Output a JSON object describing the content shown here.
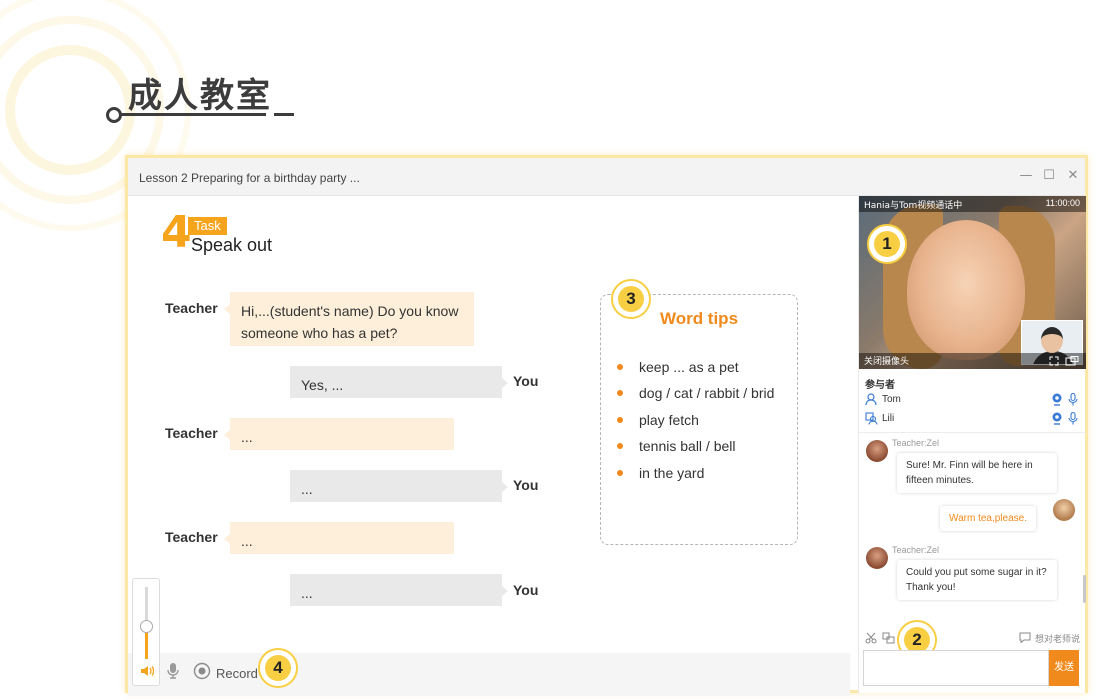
{
  "page": {
    "heading": "成人教室"
  },
  "window": {
    "title": "Lesson 2  Preparing for a birthday party ...",
    "minimize_icon": "minimize-icon",
    "maximize_icon": "maximize-icon",
    "close_icon": "close-icon",
    "minimize_label": "—",
    "maximize_label": "☐",
    "close_label": "✕"
  },
  "task": {
    "number": "4",
    "tag": "Task",
    "subtitle": "Speak out"
  },
  "dialogue": [
    {
      "speaker": "Teacher",
      "text": "Hi,...(student's name) Do you know someone who has a pet?"
    },
    {
      "speaker": "You",
      "text": "Yes, ..."
    },
    {
      "speaker": "Teacher",
      "text": "..."
    },
    {
      "speaker": "You",
      "text": "..."
    },
    {
      "speaker": "Teacher",
      "text": "..."
    },
    {
      "speaker": "You",
      "text": "..."
    }
  ],
  "word_tips": {
    "title": "Word tips",
    "items": [
      "keep ... as a pet",
      "dog / cat / rabbit / brid",
      "play fetch",
      "tennis ball / bell",
      "in the yard"
    ]
  },
  "badges": [
    "1",
    "2",
    "3",
    "4"
  ],
  "controls": {
    "record_label": "Record",
    "volume_level": 0.45,
    "speaker_icon": "speaker-icon",
    "mic_icon": "microphone-icon",
    "record_icon": "record-icon"
  },
  "video": {
    "caption": "Hania与Tom视频通话中",
    "time": "11:00:00",
    "close_camera": "关闭摄像头"
  },
  "participants": {
    "title": "参与者",
    "list": [
      {
        "name": "Tom",
        "icon": "user-icon"
      },
      {
        "name": "Lili",
        "icon": "user-group-icon"
      }
    ]
  },
  "chat": {
    "messages": [
      {
        "sender": "Teacher:Zel",
        "text": "Sure! Mr. Finn will be here in fifteen minutes.",
        "mine": false
      },
      {
        "sender": "",
        "text": "Warm tea,please.",
        "mine": true
      },
      {
        "sender": "Teacher:Zel",
        "text": "Could you put some sugar in it? Thank you!",
        "mine": false
      }
    ],
    "ask_teacher": "想对老师说",
    "send_label": "发送",
    "input_value": ""
  },
  "colors": {
    "accent": "#f08a1c",
    "badge": "#f8cf43",
    "teacher_bubble": "#fdefd9",
    "you_bubble": "#e9e9e9"
  }
}
